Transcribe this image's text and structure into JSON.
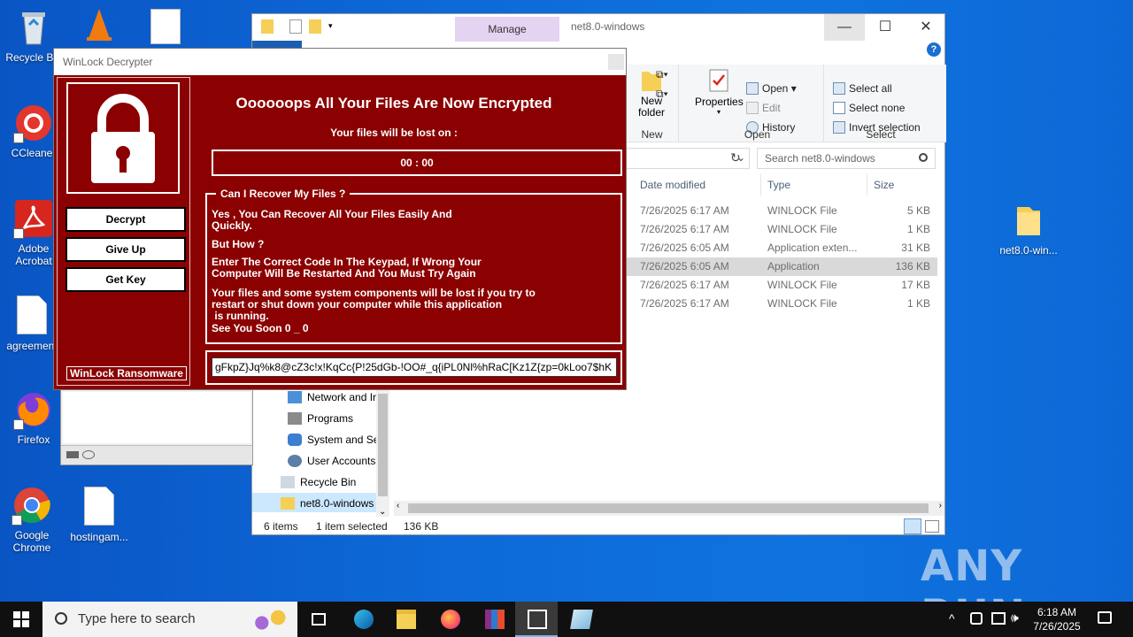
{
  "desktop": {
    "icons": [
      {
        "label": "Recycle Bin"
      },
      {
        "label": "CCleaner"
      },
      {
        "label": "Adobe Acrobat"
      },
      {
        "label": "agreement"
      },
      {
        "label": "Firefox"
      },
      {
        "label": "Google Chrome"
      },
      {
        "label": "hostingam..."
      },
      {
        "label": "net8.0-win..."
      }
    ]
  },
  "explorer": {
    "manage_tab": "Manage",
    "title": "net8.0-windows",
    "ribbon": {
      "new": {
        "new_folder": "New\nfolder",
        "group": "New"
      },
      "open": {
        "properties": "Properties",
        "open": "Open",
        "edit": "Edit",
        "history": "History",
        "group": "Open"
      },
      "select": {
        "select_all": "Select all",
        "select_none": "Select none",
        "invert": "Invert selection",
        "group": "Select"
      }
    },
    "search_placeholder": "Search net8.0-windows",
    "columns": {
      "date": "Date modified",
      "type": "Type",
      "size": "Size"
    },
    "files": [
      {
        "date": "7/26/2025 6:17 AM",
        "type": "WINLOCK File",
        "size": "5 KB"
      },
      {
        "date": "7/26/2025 6:17 AM",
        "type": "WINLOCK File",
        "size": "1 KB"
      },
      {
        "date": "7/26/2025 6:05 AM",
        "type": "Application exten...",
        "size": "31 KB"
      },
      {
        "date": "7/26/2025 6:05 AM",
        "type": "Application",
        "size": "136 KB"
      },
      {
        "date": "7/26/2025 6:17 AM",
        "type": "WINLOCK File",
        "size": "17 KB"
      },
      {
        "date": "7/26/2025 6:17 AM",
        "type": "WINLOCK File",
        "size": "1 KB"
      }
    ],
    "nav": [
      {
        "label": "Network and Ir"
      },
      {
        "label": "Programs"
      },
      {
        "label": "System and Se"
      },
      {
        "label": "User Accounts"
      },
      {
        "label": "Recycle Bin"
      },
      {
        "label": "net8.0-windows"
      }
    ],
    "status": {
      "count": "6 items",
      "selected": "1 item selected",
      "size": "136 KB"
    }
  },
  "ransom": {
    "window_title": "WinLock Decrypter",
    "headline": "Oooooops All Your Files Are Now Encrypted",
    "subline": "Your files will be lost on :",
    "timer": "00 : 00",
    "buttons": {
      "decrypt": "Decrypt",
      "give_up": "Give Up",
      "get_key": "Get Key"
    },
    "brand": "WinLock Ransomware",
    "recover_title": "Can I Recover My Files ?",
    "p1": "Yes , You Can Recover All Your Files Easily And\nQuickly.",
    "p2": "But How ?",
    "p3": "Enter The Correct Code In The Keypad, If Wrong Your\nComputer Will Be Restarted And You Must Try Again",
    "p4": "Your files and some system components will be lost if you try to\nrestart or shut down your computer while this application\n is running.",
    "p5": "See You Soon 0 _ 0",
    "key_value": "gFkpZ}Jq%k8@cZ3c!x!KqCc{P!25dGb-!OO#_q{iPL0Nl%hRaC[Kz1Z{zp=0kLoo7$hK"
  },
  "taskbar": {
    "search_placeholder": "Type here to search",
    "time": "6:18 AM",
    "date": "7/26/2025"
  },
  "watermark": "ANY RUN"
}
